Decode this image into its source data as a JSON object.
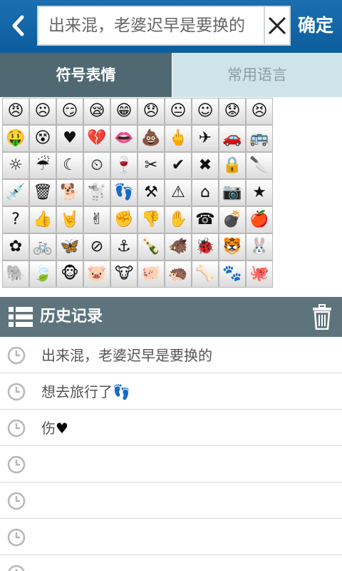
{
  "header": {
    "search_value": "出来混，老婆迟早是要换的",
    "confirm_label": "确定"
  },
  "tabs": [
    {
      "label": "符号表情",
      "active": true
    },
    {
      "label": "常用语言",
      "active": false
    }
  ],
  "emoji_grid": [
    [
      "angry-face",
      "frown-face",
      "smirk-face",
      "sleepy-face",
      "grin-face",
      "sad-face",
      "neutral-face",
      "smile-face",
      "worried-face",
      "cross-face"
    ],
    [
      "money-face",
      "dizzy-face",
      "heart",
      "broken-heart",
      "lips",
      "poop",
      "middle-finger",
      "airplane",
      "car",
      "bus"
    ],
    [
      "sun",
      "rain-cloud",
      "moon",
      "clock",
      "wine-glass",
      "scissors",
      "check-mark",
      "x-mark",
      "lock",
      "knife"
    ],
    [
      "syringe",
      "trash-can",
      "dog",
      "running-dog",
      "flip-flops",
      "axe",
      "warning",
      "house",
      "camera",
      "star"
    ],
    [
      "question-mark",
      "thumbs-up",
      "rock-hand",
      "peace-hand",
      "fist",
      "thumbs-down",
      "raised-hand",
      "phone",
      "cannon",
      "apple"
    ],
    [
      "flower",
      "bicycle",
      "butterfly",
      "no-sign",
      "anchor",
      "bottles",
      "pig-head",
      "bug",
      "tiger-face",
      "rabbit"
    ],
    [
      "elephant",
      "leaf",
      "monkey",
      "hippo",
      "cow-face",
      "pig",
      "hedgehog",
      "bone",
      "paw-print",
      "octopus"
    ]
  ],
  "history": {
    "title": "历史记录",
    "items": [
      {
        "text": "出来混，老婆迟早是要换的",
        "emoji": ""
      },
      {
        "text": "想去旅行了",
        "emoji": "👣"
      },
      {
        "text": "伤",
        "emoji": "♥"
      },
      {
        "text": "",
        "emoji": ""
      },
      {
        "text": "",
        "emoji": ""
      },
      {
        "text": "",
        "emoji": ""
      },
      {
        "text": "",
        "emoji": ""
      }
    ]
  },
  "colors": {
    "topbar": "#0c5d9d",
    "active_tab": "#4f6872",
    "inactive_tab": "#cfe4e8",
    "history_bar": "#5e747c"
  }
}
